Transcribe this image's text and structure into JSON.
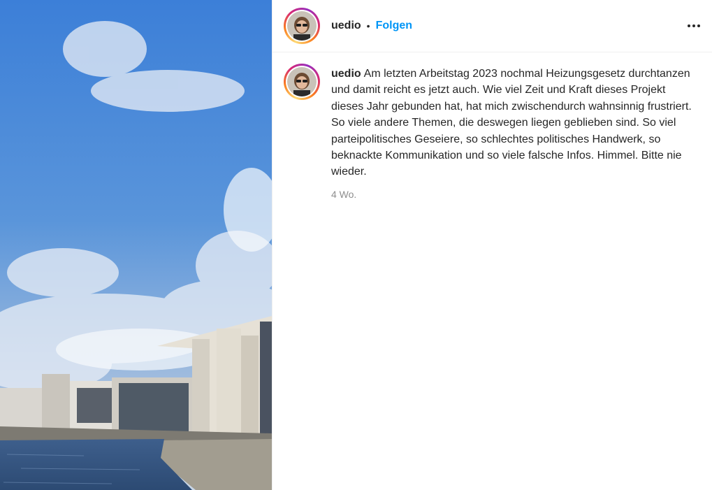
{
  "post": {
    "username": "uedio",
    "separator": "•",
    "follow_label": "Folgen",
    "more_icon": "more-options-icon",
    "caption": {
      "username": "uedio",
      "text": "Am letzten Arbeitstag 2023 nochmal Heizungsgesetz durchtanzen und damit reicht es jetzt auch. Wie viel Zeit und Kraft dieses Projekt dieses Jahr gebunden hat, hat mich zwischendurch wahnsinnig frustriert. So viele andere Themen, die deswegen liegen geblieben sind. So viel parteipolitisches Geseiere, so schlechtes politisches Handwerk, so beknackte Kommunikation und so viele falsche Infos. Himmel. Bitte nie wieder.",
      "time": "4 Wo."
    },
    "colors": {
      "accent": "#0095f6",
      "text": "#262626",
      "muted": "#8e8e8e"
    }
  }
}
